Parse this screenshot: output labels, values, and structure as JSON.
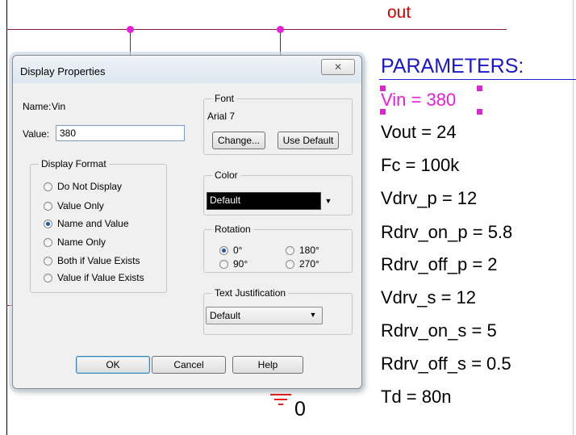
{
  "schematic": {
    "net_label": "out",
    "params_title": "PARAMETERS:",
    "parameters": [
      "Vin = 380",
      "Vout = 24",
      "Fc = 100k",
      "Vdrv_p = 12",
      "Rdrv_on_p = 5.8",
      "Rdrv_off_p = 2",
      "Vdrv_s = 12",
      "Rdrv_on_s = 5",
      "Rdrv_off_s = 0.5",
      "Td = 80n"
    ],
    "ground_label": "0",
    "colors": {
      "wire": "#8b1a3a",
      "junction": "#e81ed8",
      "net_label": "#d40000",
      "params_title": "#1a18c8",
      "selected": "#e81ed8"
    }
  },
  "dialog": {
    "title": "Display Properties",
    "close_icon": "close-icon",
    "name_label": "Name:",
    "name_value": "Vin",
    "value_label": "Value:",
    "value_input": "380",
    "font": {
      "group_title": "Font",
      "current": "Arial 7",
      "change_label": "Change...",
      "use_default_label": "Use Default"
    },
    "display_format": {
      "group_title": "Display Format",
      "options": [
        {
          "label": "Do Not Display",
          "selected": false
        },
        {
          "label": "Value Only",
          "selected": false
        },
        {
          "label": "Name and Value",
          "selected": true
        },
        {
          "label": "Name Only",
          "selected": false
        },
        {
          "label": "Both if Value Exists",
          "selected": false
        },
        {
          "label": "Value if Value Exists",
          "selected": false
        }
      ]
    },
    "color": {
      "group_title": "Color",
      "selected": "Default"
    },
    "rotation": {
      "group_title": "Rotation",
      "options": [
        {
          "label": "0°",
          "selected": true
        },
        {
          "label": "180°",
          "selected": false
        },
        {
          "label": "90°",
          "selected": false
        },
        {
          "label": "270°",
          "selected": false
        }
      ]
    },
    "justification": {
      "group_title": "Text Justification",
      "selected": "Default"
    },
    "buttons": {
      "ok": "OK",
      "cancel": "Cancel",
      "help": "Help"
    }
  }
}
